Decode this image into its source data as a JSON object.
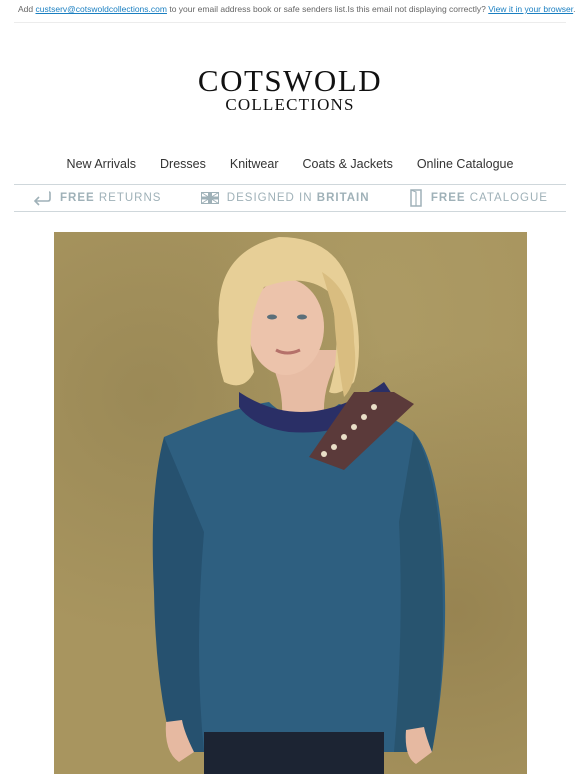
{
  "preheader": {
    "add_prefix": "Add",
    "email": "custserv@cotswoldcollections.com",
    "add_suffix": "to your email address book or safe senders list.",
    "display_question": "Is this email not displaying correctly?",
    "view_link": "View it in your browser",
    "period": "."
  },
  "logo": {
    "line1": "COTSWOLD",
    "line2": "COLLECTIONS"
  },
  "nav": {
    "items": [
      {
        "label": "New Arrivals"
      },
      {
        "label": "Dresses"
      },
      {
        "label": "Knitwear"
      },
      {
        "label": "Coats & Jackets"
      },
      {
        "label": "Online Catalogue"
      }
    ]
  },
  "usp": {
    "returns": {
      "bold": "FREE",
      "rest": "RETURNS",
      "icon": "return-arrow-icon"
    },
    "britain": {
      "light": "DESIGNED IN",
      "bold": "BRITAIN",
      "icon": "union-flag-icon"
    },
    "catalogue": {
      "bold": "FREE",
      "rest": "CATALOGUE",
      "icon": "catalogue-book-icon"
    },
    "color": "#9fb1b8"
  },
  "hero": {
    "alt": "Model wearing a teal blue crew neck knitted jumper with a navy and cream printed neck scarf",
    "background_color": "#a8955f",
    "jumper_color": "#2e5f80"
  }
}
